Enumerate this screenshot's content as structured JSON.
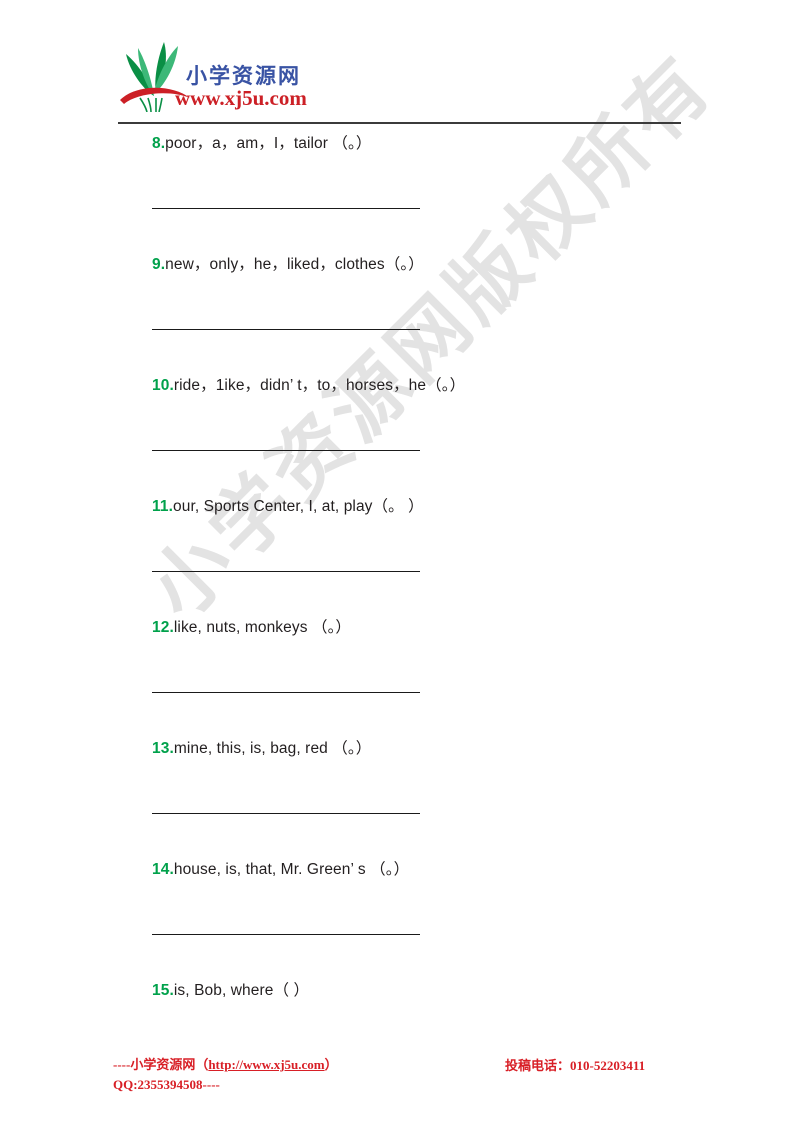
{
  "document": {
    "title": "小学资源网 English word-ordering worksheet",
    "background_color": "#ffffff"
  },
  "watermark": {
    "text": "小学资源网版权所有",
    "color": "#e2e2e2",
    "angle_deg": -45
  },
  "header": {
    "logo": {
      "icon_name": "sprout-logo",
      "leaf_color_dark": "#0a8f45",
      "leaf_color_light": "#3cb878",
      "arc_color": "#cc2026",
      "brand_cn": "小学资源网",
      "brand_cn_color": "#3953a4",
      "brand_url": "www.xj5u.com",
      "brand_url_color": "#cc2026"
    },
    "rule_color": "#3b3b3b"
  },
  "questions": [
    {
      "number": "8.",
      "text": "poor，a，am，I，tailor （。）",
      "has_answer_line": true
    },
    {
      "number": "9.",
      "text": "new，only，he，liked，clothes（。）",
      "has_answer_line": true
    },
    {
      "number": "10.",
      "text": "ride，1ike，didn’ t，to，horses，he（。）",
      "has_answer_line": true
    },
    {
      "number": "11.",
      "text": "our, Sports Center, I, at, play（。 ）",
      "has_answer_line": true
    },
    {
      "number": "12.",
      "text": "like, nuts, monkeys （。）",
      "has_answer_line": true
    },
    {
      "number": "13.",
      "text": "mine, this, is, bag, red （。）",
      "has_answer_line": true
    },
    {
      "number": "14.",
      "text": "house, is, that, Mr. Green’ s （。）",
      "has_answer_line": true
    },
    {
      "number": "15.",
      "text": "is, Bob, where（ ）",
      "has_answer_line": false
    }
  ],
  "number_color": "#00a14b",
  "text_color": "#231f20",
  "footer": {
    "left_prefix": "----小学资源网（",
    "left_link": "http://www.xj5u.com",
    "left_suffix": "）",
    "left_line2": "QQ:2355394508----",
    "right": "投稿电话：010-52203411",
    "color": "#d81f26"
  }
}
